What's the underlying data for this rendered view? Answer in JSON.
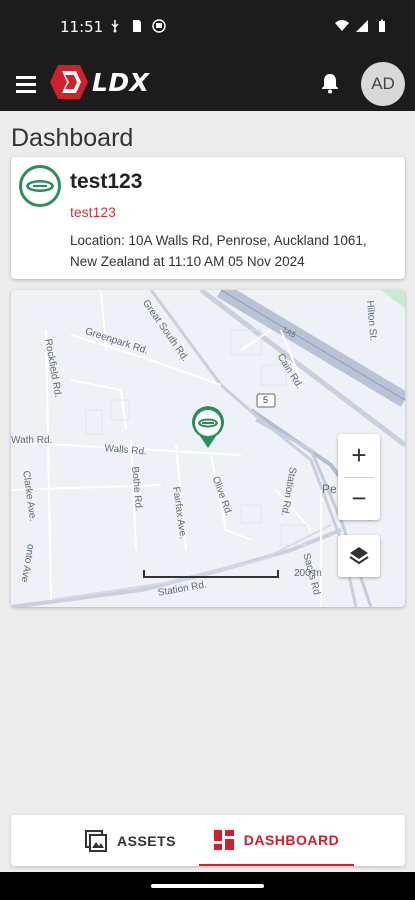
{
  "status_bar": {
    "time": "11:51"
  },
  "app_bar": {
    "logo_text": "LDX",
    "avatar_initials": "AD"
  },
  "page": {
    "title": "Dashboard"
  },
  "asset_card": {
    "name": "test123",
    "subtitle": "test123",
    "location": "Location: 10A Walls Rd, Penrose, Auckland 1061, New Zealand at 11:10 AM 05 Nov 2024"
  },
  "map": {
    "labels": {
      "great_south": "Great South Rd.",
      "greenpark": "Greenpark Rd.",
      "rockfield": "Rockfield Rd.",
      "cain": "Cain Rd.",
      "walls": "Walls Rd.",
      "wath": "Wath Rd.",
      "bothe": "Bothe Rd.",
      "fairfax": "Fairfax Ave.",
      "olive": "Olive Rd.",
      "station_rd": "Station Rd.",
      "station_rd_lower": "Station Rd.",
      "clarke": "Clarke Ave.",
      "penrose": "Pe",
      "scale": "200 m",
      "route_5": "5",
      "fixture_left": "onto Ave",
      "fixture_right": "Sacks Rd",
      "route_top": "1A5",
      "hilton": "Hilton St."
    },
    "zoom_in": "+",
    "zoom_out": "−"
  },
  "bottom_nav": {
    "assets_label": "ASSETS",
    "dashboard_label": "DASHBOARD"
  },
  "colors": {
    "accent": "#d0202a",
    "brand_green": "#2c8f5a",
    "bar": "#1c1c1c"
  }
}
